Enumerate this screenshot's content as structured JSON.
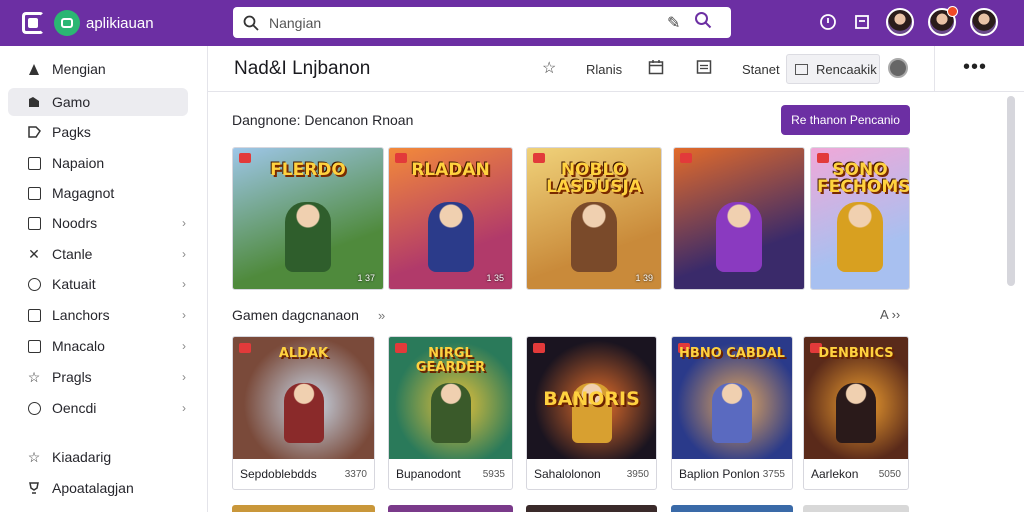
{
  "app": {
    "name": "aplikiauan",
    "brand_color": "#6c2fa3"
  },
  "search": {
    "placeholder": "Nangian"
  },
  "top_icons": [
    "help-icon",
    "window-icon",
    "user-avatar",
    "notification-avatar",
    "profile-avatar"
  ],
  "sidebar": {
    "items": [
      {
        "label": "Mengian",
        "icon": "user-icon",
        "chevron": false
      },
      {
        "label": "Gamo",
        "icon": "gamepad-icon",
        "chevron": false,
        "active": true
      },
      {
        "label": "Pagks",
        "icon": "tag-icon",
        "chevron": false
      },
      {
        "label": "Napaion",
        "icon": "box-icon",
        "chevron": false
      },
      {
        "label": "Magagnot",
        "icon": "box-icon",
        "chevron": false
      },
      {
        "label": "Noodrs",
        "icon": "box-icon",
        "chevron": true
      },
      {
        "label": "Ctanle",
        "icon": "cross-icon",
        "chevron": true
      },
      {
        "label": "Katuait",
        "icon": "circle-icon",
        "chevron": true
      },
      {
        "label": "Lanchors",
        "icon": "box-icon",
        "chevron": true
      },
      {
        "label": "Mnacalo",
        "icon": "box-icon",
        "chevron": true
      },
      {
        "label": "Pragls",
        "icon": "star-icon",
        "chevron": true
      },
      {
        "label": "Oencdi",
        "icon": "circle-icon",
        "chevron": true
      }
    ],
    "footer": [
      {
        "label": "Kiaadarig",
        "icon": "star-icon"
      },
      {
        "label": "Apoatalagjan",
        "icon": "trophy-icon"
      }
    ]
  },
  "header": {
    "title": "Nad&I Lnjbanon",
    "links": [
      "Rlanis",
      "Stanet"
    ],
    "select_value": "Rencaakik"
  },
  "featured": {
    "title": "Dangnone: Dencanon Rnoan",
    "cta": "Re thanon Pencanio",
    "tiles": [
      {
        "name": "FLERDO",
        "meta": "1 37",
        "bg": "#4f8a3c",
        "bg2": "#9ec6e8",
        "hero": "#2f5e2c"
      },
      {
        "name": "RLADAN",
        "meta": "1 35",
        "bg": "#b13a6a",
        "bg2": "#f38a3a",
        "hero": "#2b3b8a"
      },
      {
        "name": "NOBLO LASDUSJA",
        "meta": "1 39",
        "bg": "#c98a3a",
        "bg2": "#f0d27a",
        "hero": "#7a4a2a"
      },
      {
        "name": "",
        "meta": "",
        "bg": "#3a2a6a",
        "bg2": "#e26b2a",
        "hero": "#8a3ac0"
      },
      {
        "name": "SONO FECHOMS",
        "meta": "",
        "bg": "#a8c0f0",
        "bg2": "#f0a8d8",
        "hero": "#d8a020"
      }
    ]
  },
  "popular": {
    "title": "Gamen dagcnanaon",
    "cards": [
      {
        "name": "ALDAK",
        "caption": "Sepdoblebdds",
        "count": "3370",
        "bg": "#7a4a3a",
        "bg2": "#c9d8e8",
        "hero": "#8a2a2a"
      },
      {
        "name": "NIRGL GEARDER",
        "caption": "Bupanodont",
        "count": "5935",
        "bg": "#2a7a5a",
        "bg2": "#e8c23a",
        "hero": "#3a5a2a"
      },
      {
        "name": "BANORIS",
        "caption": "Sahalolonon",
        "count": "3950",
        "bg": "#1a1420",
        "bg2": "#e8702a",
        "hero": "#d8a030"
      },
      {
        "name": "HBNO CABDAL",
        "caption": "Baplion Ponlon",
        "count": "3755",
        "bg": "#2a3a8a",
        "bg2": "#e8a85a",
        "hero": "#5a6ac0"
      },
      {
        "name": "DENBNICS",
        "caption": "Aarlekon",
        "count": "5050",
        "bg": "#5a2a1a",
        "bg2": "#f0a030",
        "hero": "#2a1a1a"
      }
    ]
  }
}
